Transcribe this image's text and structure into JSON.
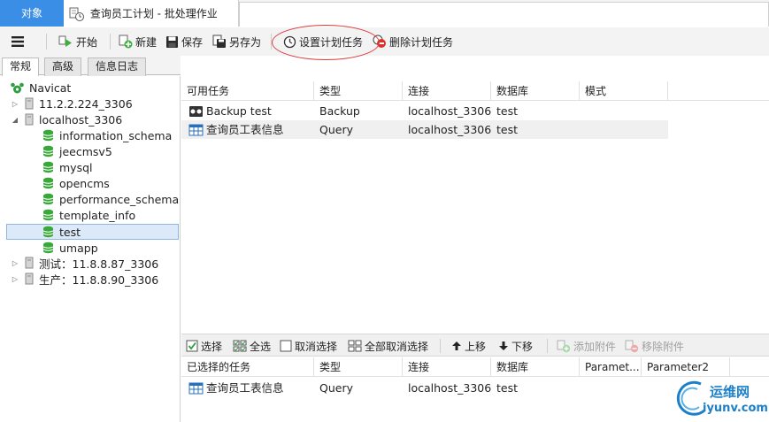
{
  "tabs": {
    "object_label": "对象",
    "doc_title": "查询员工计划 - 批处理作业"
  },
  "toolbar": {
    "start": "开始",
    "new": "新建",
    "save": "保存",
    "save_as": "另存为",
    "set_schedule": "设置计划任务",
    "delete_schedule": "删除计划任务"
  },
  "left_tabs": [
    "常规",
    "高级",
    "信息日志"
  ],
  "tree": {
    "root": "Navicat",
    "nodes": [
      {
        "label": "11.2.2.224_3306",
        "type": "server",
        "expanded": false
      },
      {
        "label": "localhost_3306",
        "type": "server",
        "expanded": true
      },
      {
        "label": "information_schema",
        "type": "db"
      },
      {
        "label": "jeecmsv5",
        "type": "db"
      },
      {
        "label": "mysql",
        "type": "db"
      },
      {
        "label": "opencms",
        "type": "db"
      },
      {
        "label": "performance_schema",
        "type": "db"
      },
      {
        "label": "template_info",
        "type": "db"
      },
      {
        "label": "test",
        "type": "db",
        "selected": true
      },
      {
        "label": "umapp",
        "type": "db"
      },
      {
        "label": "测试：11.8.8.87_3306",
        "type": "server",
        "expanded": false
      },
      {
        "label": "生产：11.8.8.90_3306",
        "type": "server",
        "expanded": false
      }
    ]
  },
  "available": {
    "headers": [
      "可用任务",
      "类型",
      "连接",
      "数据库",
      "模式"
    ],
    "rows": [
      {
        "task": "Backup test",
        "type": "Backup",
        "conn": "localhost_3306",
        "db": "test",
        "icon": "backup"
      },
      {
        "task": "查询员工表信息",
        "type": "Query",
        "conn": "localhost_3306",
        "db": "test",
        "icon": "query"
      }
    ]
  },
  "middle_toolbar": {
    "select": "选择",
    "select_all": "全选",
    "deselect": "取消选择",
    "deselect_all": "全部取消选择",
    "move_up": "上移",
    "move_down": "下移",
    "add_attachment": "添加附件",
    "remove_attachment": "移除附件"
  },
  "selected": {
    "headers": [
      "已选择的任务",
      "类型",
      "连接",
      "数据库",
      "Paramet...",
      "Parameter2"
    ],
    "rows": [
      {
        "task": "查询员工表信息",
        "type": "Query",
        "conn": "localhost_3306",
        "db": "test",
        "icon": "query"
      }
    ]
  },
  "watermark": {
    "cn": "运维网",
    "en": "iyunv.com"
  },
  "colors": {
    "accent": "#3a8ee6",
    "selection": "#dbe9f9",
    "annotation": "#e03a3a"
  }
}
